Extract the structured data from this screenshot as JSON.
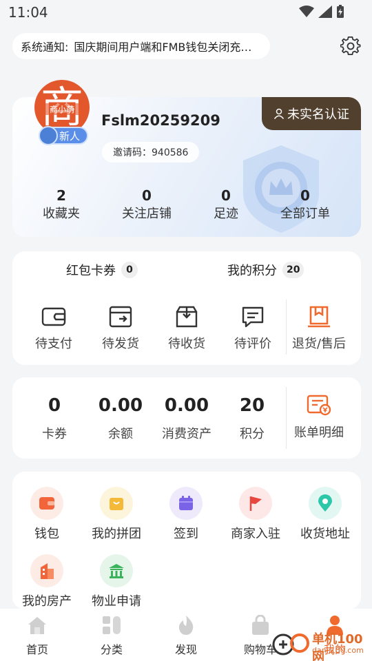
{
  "status_bar": {
    "time": "11:04"
  },
  "notice": {
    "label": "系统通知:",
    "message": "国庆期间用户端和FMB钱包关闭充值入口的通知"
  },
  "profile": {
    "verify_label": "未实名认证",
    "avatar_char": "商",
    "avatar_brand": "商小萌",
    "new_badge": "新人",
    "username": "Fslm20259209",
    "invite": "邀请码：940586",
    "stats": [
      {
        "value": "2",
        "label": "收藏夹"
      },
      {
        "value": "0",
        "label": "关注店铺"
      },
      {
        "value": "0",
        "label": "足迹"
      },
      {
        "value": "0",
        "label": "全部订单"
      }
    ]
  },
  "orders": {
    "coupon_label": "红包卡券",
    "coupon_count": "0",
    "points_label": "我的积分",
    "points_count": "20",
    "items": [
      {
        "label": "待支付",
        "icon": "wallet-icon"
      },
      {
        "label": "待发货",
        "icon": "box-send-icon"
      },
      {
        "label": "待收货",
        "icon": "package-receive-icon"
      },
      {
        "label": "待评价",
        "icon": "comment-icon"
      },
      {
        "label": "退货/售后",
        "icon": "return-icon"
      }
    ]
  },
  "assets": {
    "items": [
      {
        "value": "0",
        "label": "卡券"
      },
      {
        "value": "0.00",
        "label": "余额"
      },
      {
        "value": "0.00",
        "label": "消费资产"
      },
      {
        "value": "20",
        "label": "积分"
      }
    ],
    "bill_label": "账单明细"
  },
  "tools": {
    "items": [
      {
        "label": "钱包",
        "icon": "wallet-icon",
        "color": "#f2643a",
        "bg": "#fdece6"
      },
      {
        "label": "我的拼团",
        "icon": "shopping-bag-icon",
        "color": "#f5b93a",
        "bg": "#fdf4dc"
      },
      {
        "label": "签到",
        "icon": "calendar-icon",
        "color": "#7b63e8",
        "bg": "#eeeafc"
      },
      {
        "label": "商家入驻",
        "icon": "flag-icon",
        "color": "#e8473f",
        "bg": "#fde8e7"
      },
      {
        "label": "收货地址",
        "icon": "location-pin-icon",
        "color": "#2cc7a8",
        "bg": "#e2f7f2"
      },
      {
        "label": "我的房产",
        "icon": "building-icon",
        "color": "#f2643a",
        "bg": "#fdece6"
      },
      {
        "label": "物业申请",
        "icon": "bank-icon",
        "color": "#3bb35d",
        "bg": "#e5f5e9"
      }
    ]
  },
  "tabbar": {
    "items": [
      {
        "label": "首页",
        "icon": "home-icon"
      },
      {
        "label": "分类",
        "icon": "category-icon"
      },
      {
        "label": "发现",
        "icon": "discover-flame-icon"
      },
      {
        "label": "购物车",
        "icon": "cart-bag-icon"
      },
      {
        "label": "我的",
        "icon": "person-icon"
      }
    ],
    "active_color": "#e8642c"
  },
  "watermark": {
    "line1": "单机100网",
    "line2": "danji100.com"
  }
}
